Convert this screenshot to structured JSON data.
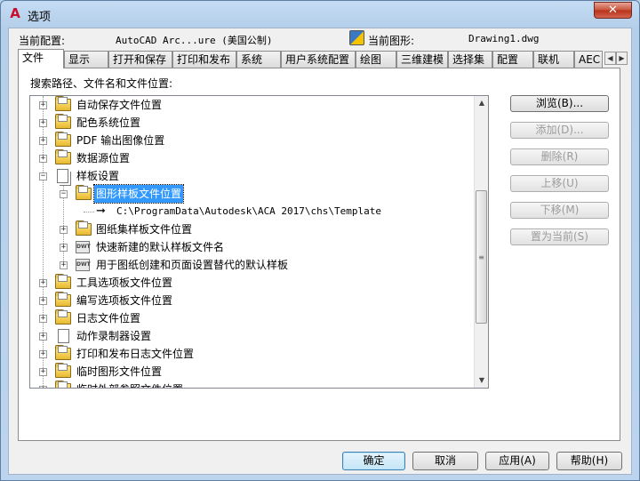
{
  "window": {
    "title": "选项",
    "close_symbol": "✕",
    "app_letter": "A"
  },
  "config": {
    "profile_label": "当前配置:",
    "profile_value": "AutoCAD Arc...ure (美国公制)",
    "drawing_label": "当前图形:",
    "drawing_value": "Drawing1.dwg"
  },
  "tabs": [
    "文件",
    "显示",
    "打开和保存",
    "打印和发布",
    "系统",
    "用户系统配置",
    "绘图",
    "三维建模",
    "选择集",
    "配置",
    "联机",
    "AEC"
  ],
  "tab_scroll": {
    "left": "◀",
    "right": "▶"
  },
  "panel": {
    "label": "搜索路径、文件名和文件位置:"
  },
  "tree": [
    {
      "label": "自动保存文件位置",
      "icon": "folder-icon",
      "expander": "+"
    },
    {
      "label": "配色系统位置",
      "icon": "folder-icon",
      "expander": "+"
    },
    {
      "label": "PDF 输出图像位置",
      "icon": "folder-icon",
      "expander": "+"
    },
    {
      "label": "数据源位置",
      "icon": "folder-icon",
      "expander": "+"
    },
    {
      "label": "样板设置",
      "icon": "document-stack-icon",
      "expander": "−"
    },
    {
      "label": "图形样板文件位置",
      "icon": "folder-open-icon",
      "expander": "−",
      "selected": true
    },
    {
      "label": "C:\\ProgramData\\Autodesk\\ACA 2017\\chs\\Template",
      "icon": "arrow-icon"
    },
    {
      "label": "图纸集样板文件位置",
      "icon": "folder-icon",
      "expander": "+"
    },
    {
      "label": "快速新建的默认样板文件名",
      "icon": "dwt-icon",
      "expander": "+"
    },
    {
      "label": "用于图纸创建和页面设置替代的默认样板",
      "icon": "dwt-icon",
      "expander": "+"
    },
    {
      "label": "工具选项板文件位置",
      "icon": "folder-icon",
      "expander": "+"
    },
    {
      "label": "编写选项板文件位置",
      "icon": "folder-icon",
      "expander": "+"
    },
    {
      "label": "日志文件位置",
      "icon": "folder-icon",
      "expander": "+"
    },
    {
      "label": "动作录制器设置",
      "icon": "document-icon",
      "expander": "+"
    },
    {
      "label": "打印和发布日志文件位置",
      "icon": "folder-icon",
      "expander": "+"
    },
    {
      "label": "临时图形文件位置",
      "icon": "folder-icon",
      "expander": "+"
    },
    {
      "label": "临时外部参照文件位置",
      "icon": "folder-icon",
      "expander": "+"
    }
  ],
  "scroll": {
    "up": "▲",
    "down": "▼",
    "grip": "≡"
  },
  "side_buttons": {
    "browse": "浏览(B)...",
    "add": "添加(D)...",
    "remove": "删除(R)",
    "move_up": "上移(U)",
    "move_down": "下移(M)",
    "set_current": "置为当前(S)"
  },
  "bottom_buttons": {
    "ok": "确定",
    "cancel": "取消",
    "apply": "应用(A)",
    "help": "帮助(H)"
  }
}
